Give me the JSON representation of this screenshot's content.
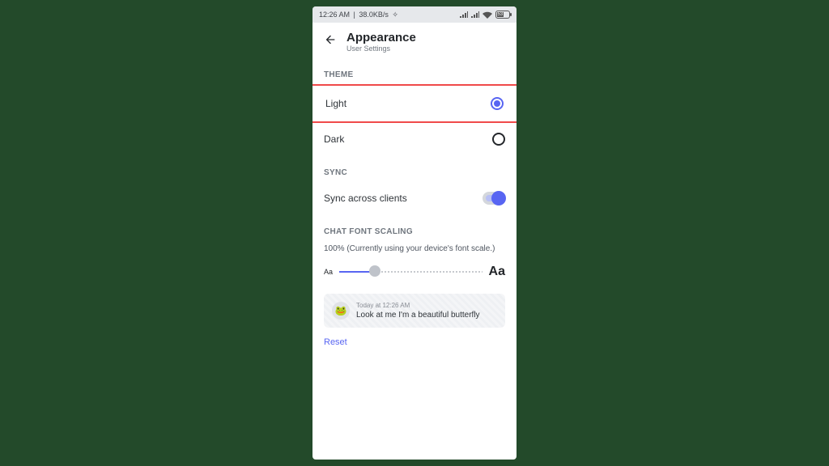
{
  "status": {
    "time": "12:26 AM",
    "net_speed": "38.0KB/s",
    "battery_pct": "53"
  },
  "header": {
    "title": "Appearance",
    "subtitle": "User Settings"
  },
  "sections": {
    "theme_label": "THEME",
    "sync_label": "SYNC",
    "font_label": "CHAT FONT SCALING"
  },
  "theme": {
    "light": "Light",
    "dark": "Dark",
    "selected": "light"
  },
  "sync": {
    "label": "Sync across clients",
    "on": true
  },
  "font": {
    "info": "100% (Currently using your device's font scale.)",
    "small_marker": "Aa",
    "large_marker": "Aa"
  },
  "preview": {
    "timestamp": "Today at 12:26 AM",
    "message": "Look at me I'm a beautiful butterfly"
  },
  "reset_label": "Reset"
}
